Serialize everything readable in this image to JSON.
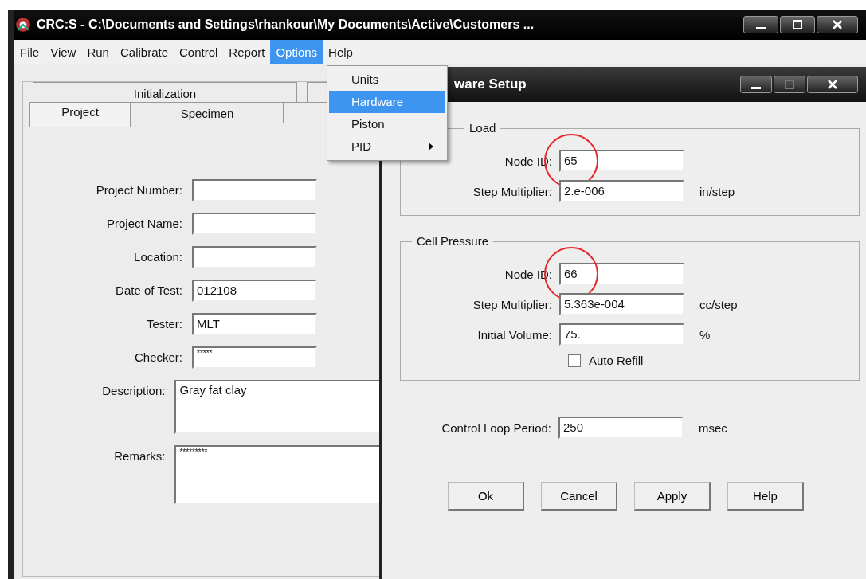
{
  "window": {
    "title": "CRC:S - C:\\Documents and Settings\\rhankour\\My Documents\\Active\\Customers ..."
  },
  "menu_bar": [
    {
      "label": "File",
      "selected": false
    },
    {
      "label": "View",
      "selected": false
    },
    {
      "label": "Run",
      "selected": false
    },
    {
      "label": "Calibrate",
      "selected": false
    },
    {
      "label": "Control",
      "selected": false
    },
    {
      "label": "Report",
      "selected": false
    },
    {
      "label": "Options",
      "selected": true
    },
    {
      "label": "Help",
      "selected": false
    }
  ],
  "options_menu": [
    {
      "label": "Units",
      "selected": false,
      "submenu": false
    },
    {
      "label": "Hardware",
      "selected": true,
      "submenu": false
    },
    {
      "label": "Piston",
      "selected": false,
      "submenu": false
    },
    {
      "label": "PID",
      "selected": false,
      "submenu": true
    }
  ],
  "tabs": {
    "top_row": [
      {
        "label": "Initialization"
      }
    ],
    "bottom_row": [
      {
        "label": "Project",
        "selected": true
      },
      {
        "label": "Specimen",
        "selected": false
      }
    ]
  },
  "project_form": [
    {
      "label": "Project Number:",
      "kind": "text"
    },
    {
      "label": "Project Name:",
      "kind": "text"
    },
    {
      "label": "Location:",
      "kind": "text"
    },
    {
      "label": "Date of Test:",
      "value": "012108",
      "kind": "text"
    },
    {
      "label": "Tester:",
      "value": "MLT",
      "kind": "text"
    },
    {
      "label": "Checker:",
      "value": "*****",
      "kind": "masked"
    },
    {
      "label": "Description:",
      "value": "Gray fat clay",
      "kind": "multiline"
    },
    {
      "label": "Remarks:",
      "value": "*********",
      "kind": "masked-multiline"
    }
  ],
  "dialog": {
    "title": "ware Setup",
    "groups": [
      {
        "legend": "Load",
        "fields": [
          {
            "label": "Node ID:",
            "value": "65",
            "highlighted": true
          },
          {
            "label": "Step Multiplier:",
            "value": "2.e-006",
            "unit": "in/step",
            "highlighted": false
          }
        ]
      },
      {
        "legend": "Cell Pressure",
        "fields": [
          {
            "label": "Node ID:",
            "value": "66",
            "highlighted": true
          },
          {
            "label": "Step Multiplier:",
            "value": "5.363e-004",
            "unit": "cc/step",
            "highlighted": false
          },
          {
            "label": "Initial Volume:",
            "value": "75.",
            "unit": "%",
            "highlighted": false
          }
        ],
        "checkbox": {
          "label": "Auto Refill",
          "checked": false
        }
      }
    ],
    "control_loop": {
      "label": "Control Loop Period:",
      "value": "250",
      "unit": "msec"
    },
    "buttons": [
      "Ok",
      "Cancel",
      "Apply",
      "Help"
    ]
  }
}
